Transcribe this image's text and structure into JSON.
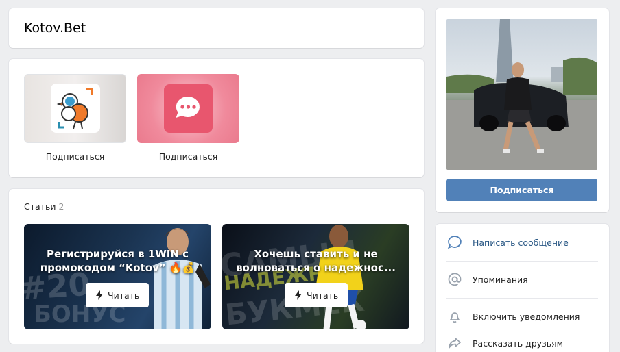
{
  "header": {
    "title": "Kotov.Bet"
  },
  "apps": [
    {
      "label": "Подписаться",
      "icon": "bird-logo-icon"
    },
    {
      "label": "Подписаться",
      "icon": "chat-bubble-icon"
    }
  ],
  "articles": {
    "heading": "Статьи",
    "count": "2",
    "items": [
      {
        "headline": "Регистрируйся в 1WIN с промокодом “Kotov” 🔥💰",
        "read_label": "Читать",
        "bg_text": "БОНУС"
      },
      {
        "headline": "Хочешь ставить и не волноваться о надежнос...",
        "read_label": "Читать",
        "bg_text": "БУКМЕК"
      }
    ]
  },
  "profile": {
    "subscribe_label": "Подписаться"
  },
  "actions": [
    {
      "label": "Написать сообщение",
      "icon": "message-icon"
    },
    {
      "label": "Упоминания",
      "icon": "at-icon"
    },
    {
      "label": "Включить уведомления",
      "icon": "bell-icon"
    },
    {
      "label": "Рассказать друзьям",
      "icon": "share-icon"
    }
  ],
  "colors": {
    "accent": "#5181b8",
    "link": "#2a5885",
    "background": "#edeef0"
  }
}
